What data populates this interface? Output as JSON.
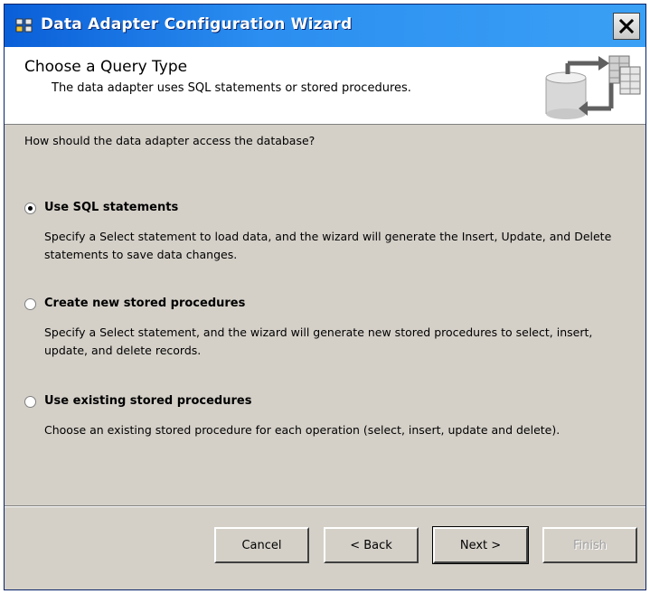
{
  "window": {
    "title": "Data Adapter Configuration Wizard",
    "close_glyph": "✕"
  },
  "header": {
    "title": "Choose a Query Type",
    "subtitle": "The data adapter uses SQL statements or stored procedures."
  },
  "main": {
    "question": "How should the data adapter access the database?",
    "options": [
      {
        "label": "Use SQL statements",
        "description": "Specify a Select statement to load data, and the wizard will generate the Insert, Update, and Delete statements to save data changes.",
        "selected": true
      },
      {
        "label": "Create new stored procedures",
        "description": "Specify a Select statement, and the wizard will generate new stored procedures to select, insert, update, and delete records.",
        "selected": false
      },
      {
        "label": "Use existing stored procedures",
        "description": "Choose an existing stored procedure for each operation (select, insert, update and delete).",
        "selected": false
      }
    ]
  },
  "footer": {
    "cancel_label": "Cancel",
    "back_label": "< Back",
    "next_label": "Next >",
    "finish_label": "Finish"
  },
  "colors": {
    "titlebar": "#2b8ef0",
    "dialog_bg": "#d4d0c8"
  }
}
